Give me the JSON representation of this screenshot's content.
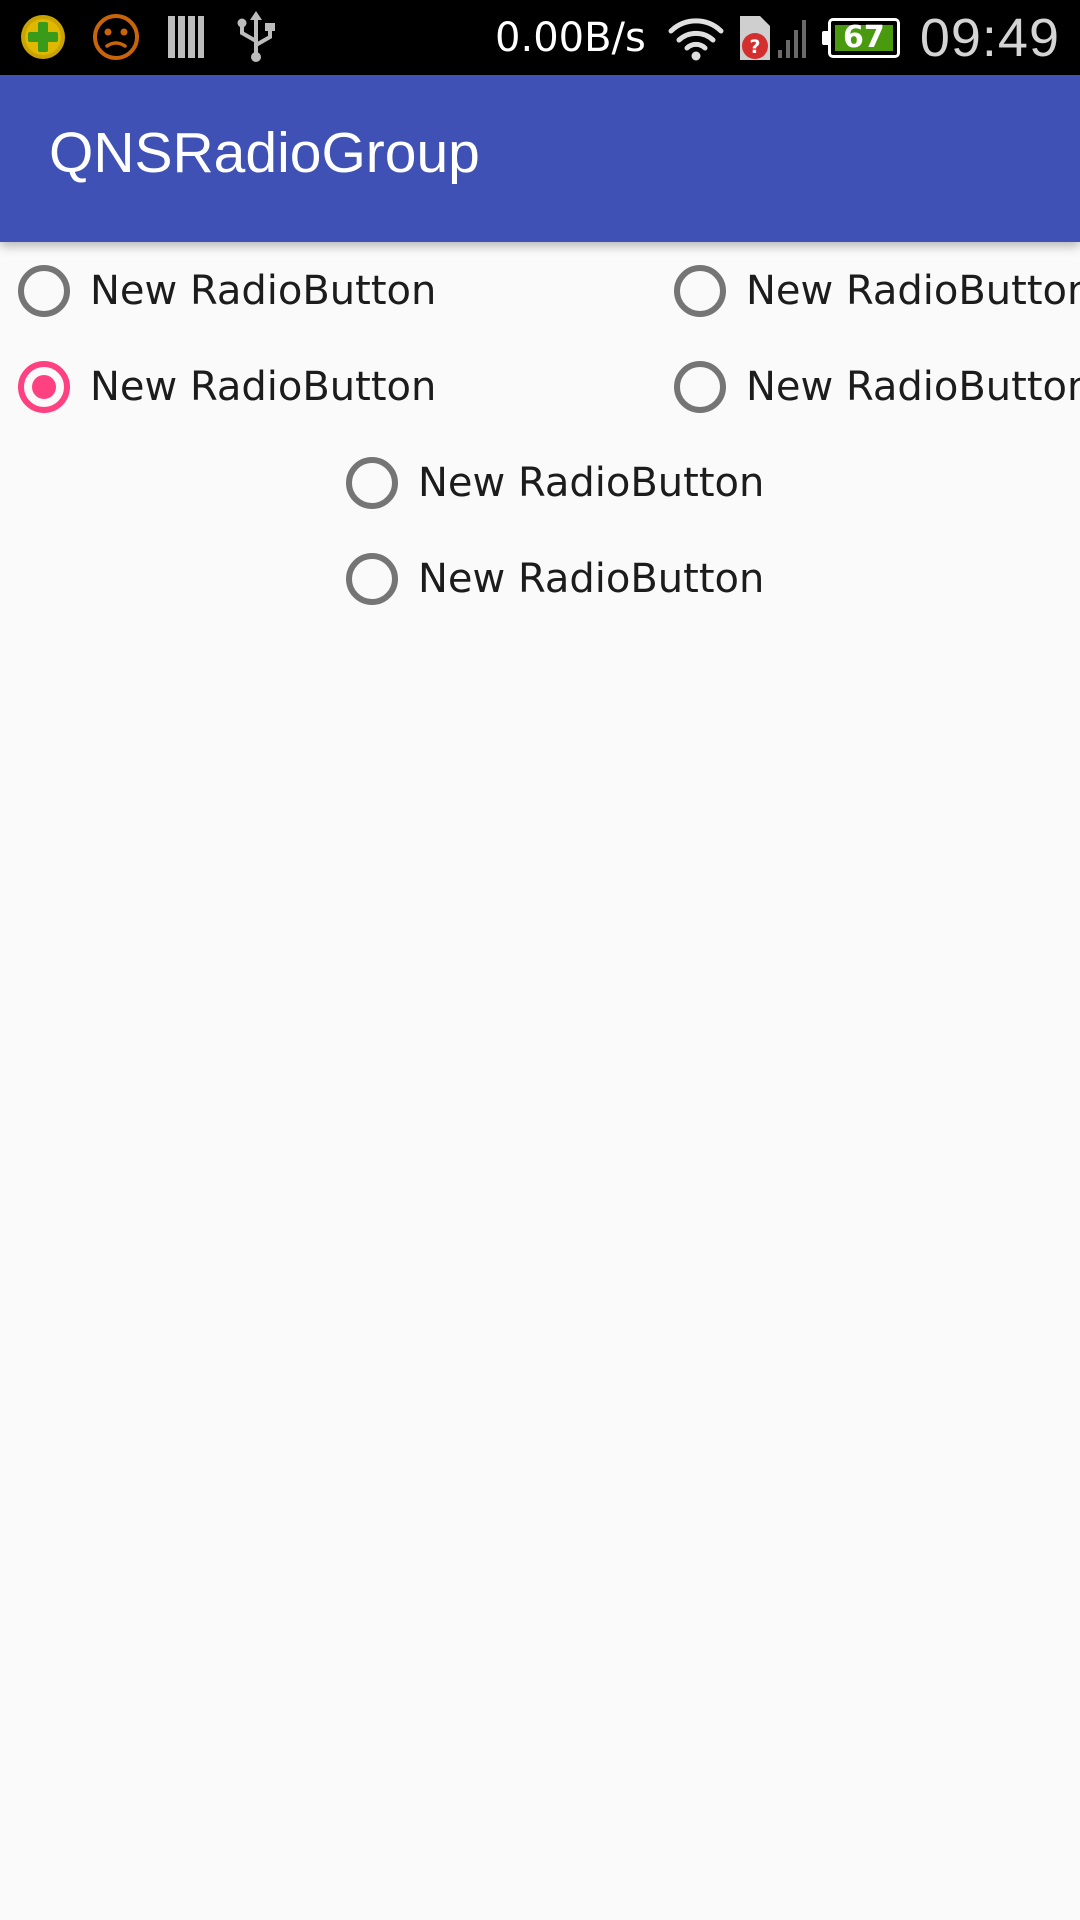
{
  "status_bar": {
    "net_speed": "0.00B/s",
    "battery_level": "67",
    "time": "09:49",
    "icons": [
      "app-notification-icon",
      "face-notification-icon",
      "library-icon",
      "usb-icon",
      "wifi-icon",
      "sim-unknown-icon",
      "signal-icon",
      "battery-icon"
    ]
  },
  "app_bar": {
    "title": "QNSRadioGroup"
  },
  "radio_buttons": [
    {
      "label": "New RadioButton",
      "checked": false
    },
    {
      "label": "New RadioButton",
      "checked": false
    },
    {
      "label": "New RadioButton",
      "checked": true
    },
    {
      "label": "New RadioButton",
      "checked": false
    },
    {
      "label": "New RadioButton",
      "checked": false
    },
    {
      "label": "New RadioButton",
      "checked": false
    }
  ],
  "colors": {
    "primary": "#3f51b5",
    "accent": "#ff4081",
    "radio_unchecked": "#757575",
    "background": "#fafafa"
  }
}
